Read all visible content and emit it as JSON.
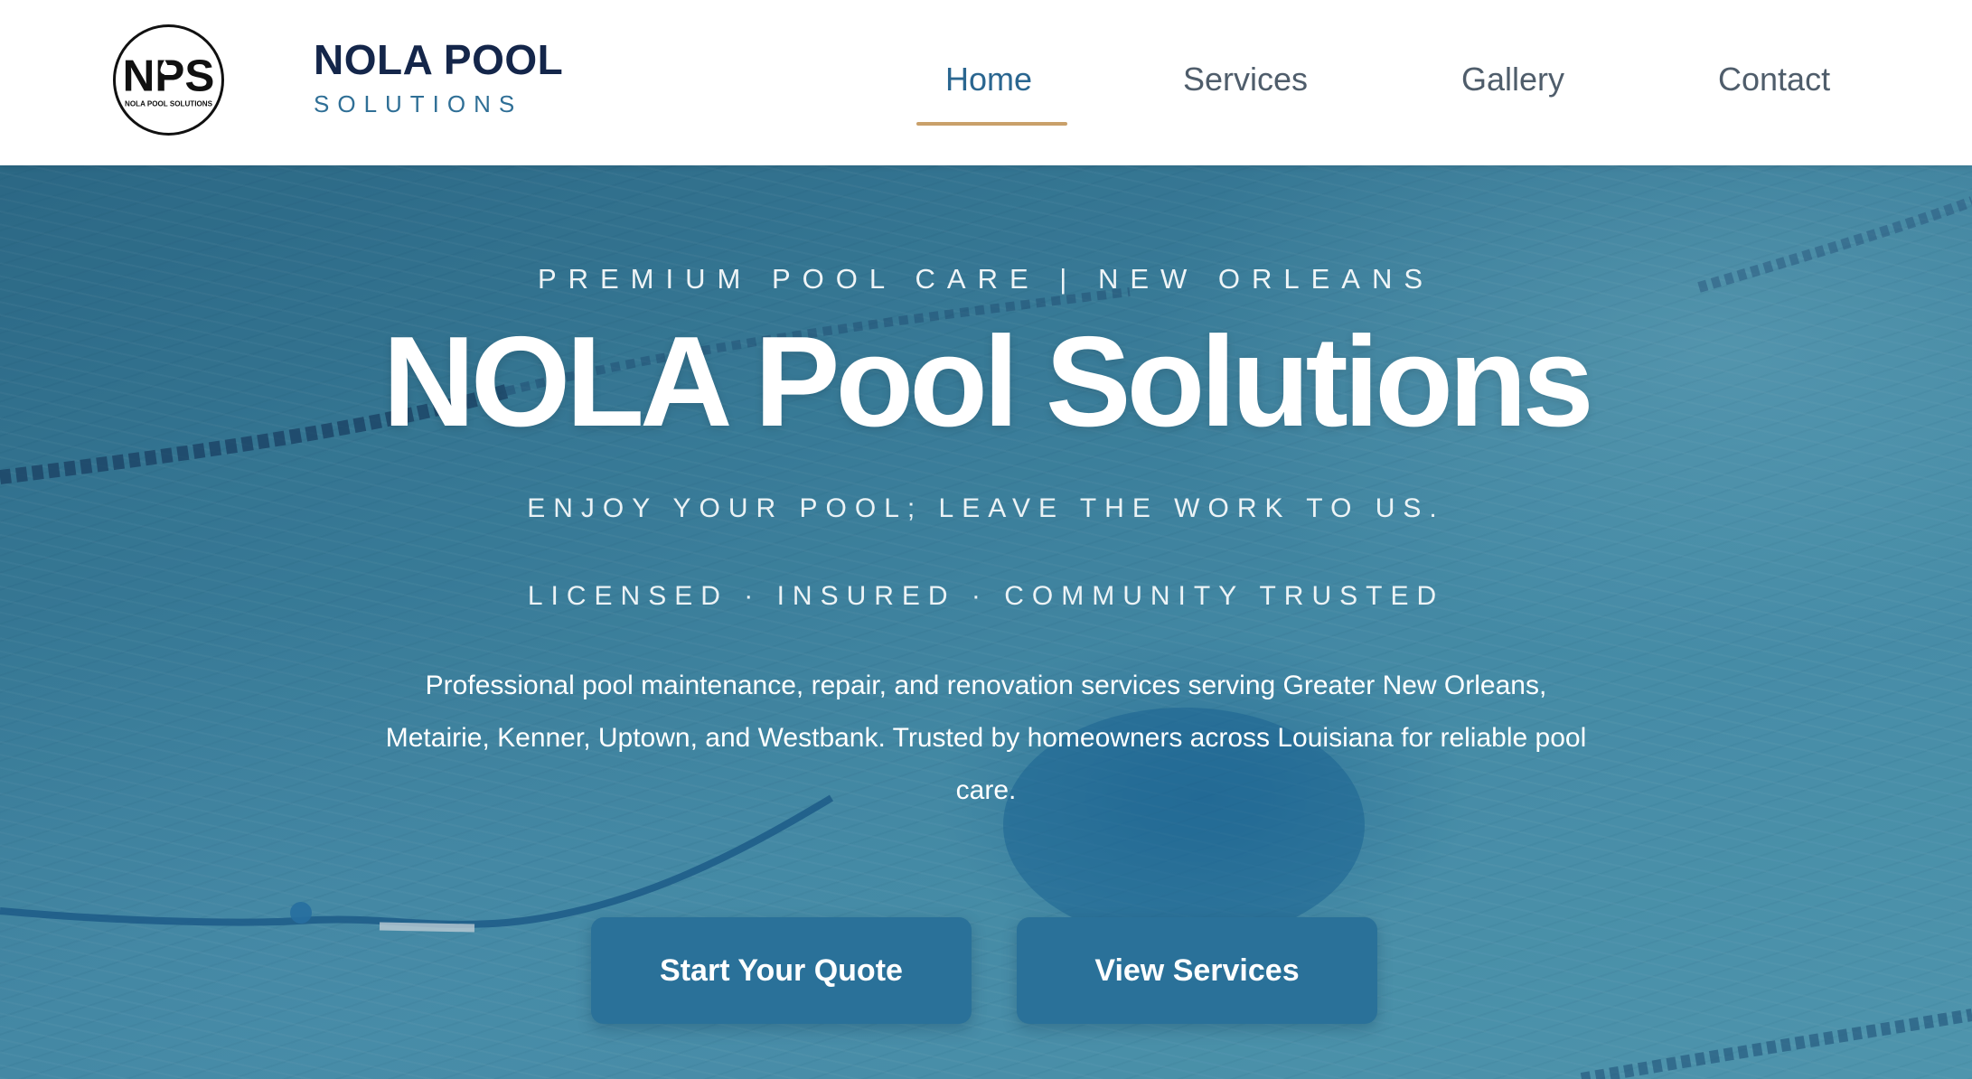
{
  "header": {
    "logo": {
      "mark": "NPS",
      "subtext": "NOLA POOL SOLUTIONS",
      "icon": "pool-droplet-logo-icon"
    },
    "brand_name": "NOLA POOL",
    "brand_tagline": "SOLUTIONS",
    "nav": {
      "items": [
        {
          "label": "Home",
          "active": true
        },
        {
          "label": "Services",
          "active": false
        },
        {
          "label": "Gallery",
          "active": false
        },
        {
          "label": "Contact",
          "active": false
        }
      ]
    }
  },
  "hero": {
    "eyebrow": "PREMIUM POOL CARE | NEW ORLEANS",
    "title": "NOLA Pool Solutions",
    "tagline": "ENJOY YOUR POOL; LEAVE THE WORK TO US.",
    "credentials": "LICENSED · INSURED · COMMUNITY TRUSTED",
    "description": "Professional pool maintenance, repair, and renovation services serving Greater New Orleans, Metairie, Kenner, Uptown, and Westbank. Trusted by homeowners across Louisiana for reliable pool care.",
    "buttons": {
      "primary": "Start Your Quote",
      "secondary": "View Services"
    },
    "background": "pool-water-image"
  },
  "colors": {
    "brand_navy": "#14264a",
    "brand_blue": "#2f6f96",
    "nav_active": "#2a6690",
    "nav_underline": "#c9a06a",
    "button_bg": "#2a7199"
  }
}
